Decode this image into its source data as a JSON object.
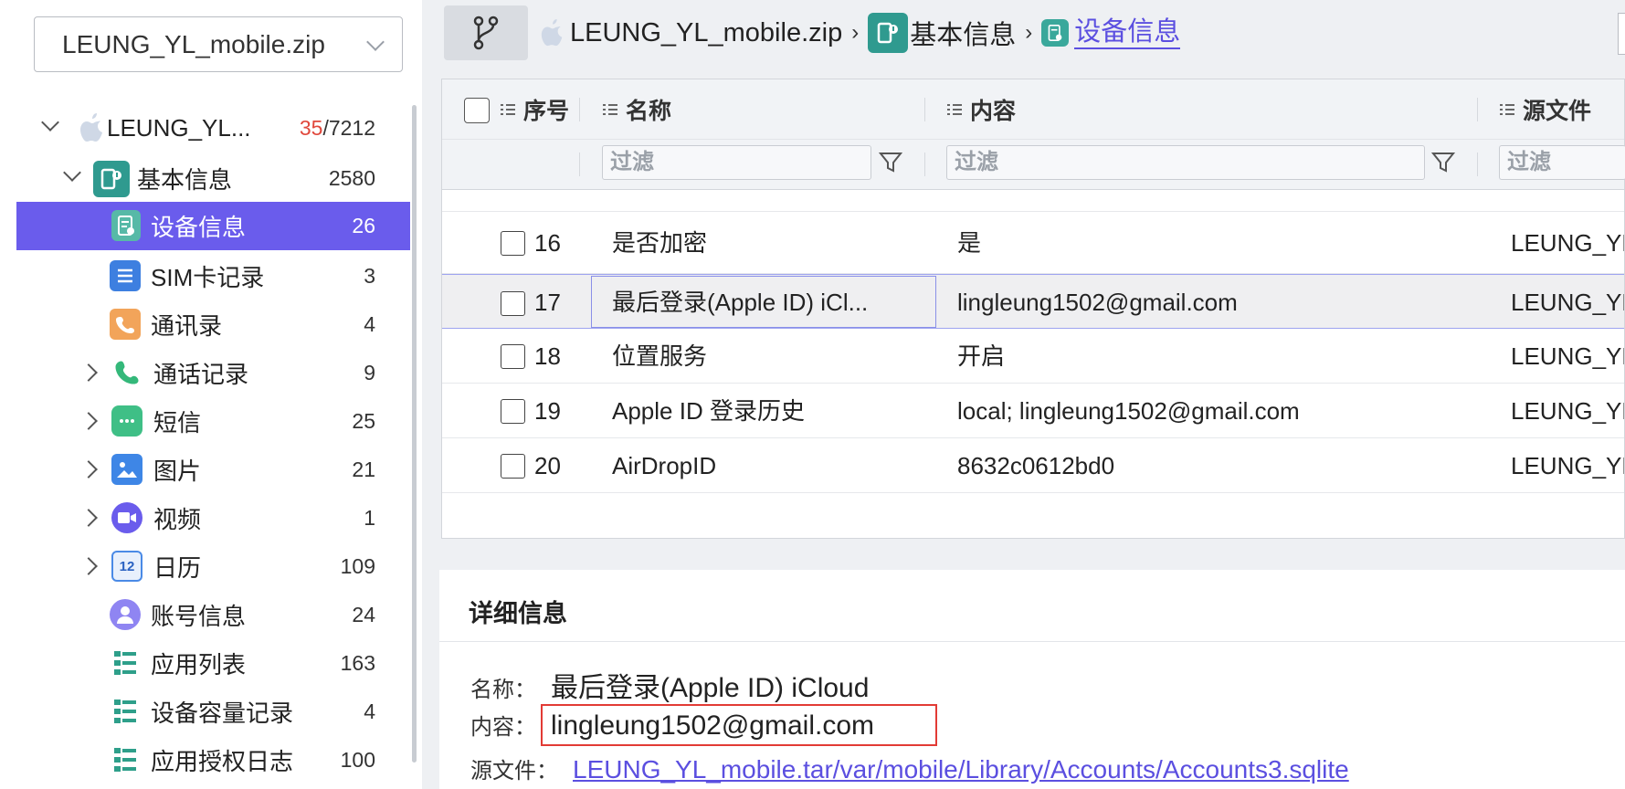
{
  "device_select": {
    "value": "LEUNG_YL_mobile.zip"
  },
  "tree": [
    {
      "label": "LEUNG_YL...",
      "count_highlight": "35",
      "count_total": "/7212",
      "expanded": true,
      "level": 0,
      "icon": "apple-icon"
    },
    {
      "label": "基本信息",
      "count": "2580",
      "expanded": true,
      "level": 1,
      "icon": "basic-info-icon"
    },
    {
      "label": "设备信息",
      "count": "26",
      "level": 2,
      "selected": true,
      "icon": "device-info-icon"
    },
    {
      "label": "SIM卡记录",
      "count": "3",
      "level": 2,
      "icon": "sim-card-icon"
    },
    {
      "label": "通讯录",
      "count": "4",
      "level": 2,
      "icon": "contacts-icon"
    },
    {
      "label": "通话记录",
      "count": "9",
      "level": 2,
      "collapsed": true,
      "icon": "phone-icon"
    },
    {
      "label": "短信",
      "count": "25",
      "level": 2,
      "collapsed": true,
      "icon": "sms-icon"
    },
    {
      "label": "图片",
      "count": "21",
      "level": 2,
      "collapsed": true,
      "icon": "image-icon"
    },
    {
      "label": "视频",
      "count": "1",
      "level": 2,
      "collapsed": true,
      "icon": "video-icon"
    },
    {
      "label": "日历",
      "count": "109",
      "level": 2,
      "collapsed": true,
      "icon": "calendar-icon"
    },
    {
      "label": "账号信息",
      "count": "24",
      "level": 2,
      "icon": "account-icon"
    },
    {
      "label": "应用列表",
      "count": "163",
      "level": 2,
      "icon": "app-list-icon"
    },
    {
      "label": "设备容量记录",
      "count": "4",
      "level": 2,
      "icon": "storage-record-icon"
    },
    {
      "label": "应用授权日志",
      "count": "100",
      "level": 2,
      "icon": "app-auth-log-icon"
    }
  ],
  "breadcrumb": {
    "root": "LEUNG_YL_mobile.zip",
    "sep": "›",
    "level1": "基本信息",
    "current": "设备信息"
  },
  "table": {
    "columns": [
      "序号",
      "名称",
      "内容",
      "源文件"
    ],
    "filter_placeholder": "过滤",
    "rows": [
      {
        "index": "16",
        "name": "是否加密",
        "content": "是",
        "source": "LEUNG_YL"
      },
      {
        "index": "17",
        "name": "最后登录(Apple ID) iCl...",
        "content": "lingleung1502@gmail.com",
        "source": "LEUNG_YL",
        "selected": true
      },
      {
        "index": "18",
        "name": "位置服务",
        "content": "开启",
        "source": "LEUNG_YL"
      },
      {
        "index": "19",
        "name": "Apple ID 登录历史",
        "content": "local; lingleung1502@gmail.com",
        "source": "LEUNG_YL"
      },
      {
        "index": "20",
        "name": "AirDropID",
        "content": "8632c0612bd0",
        "source": "LEUNG_YL"
      }
    ]
  },
  "detail": {
    "title": "详细信息",
    "name_label": "名称：",
    "name_value": "最后登录(Apple ID) iCloud",
    "content_label": "内容：",
    "content_value": "lingleung1502@gmail.com",
    "source_label": "源文件：",
    "source_value": "LEUNG_YL_mobile.tar/var/mobile/Library/Accounts/Accounts3.sqlite"
  },
  "colors": {
    "accent": "#6a5cec",
    "link": "#5b4fe0",
    "highlight_box": "#e23b35",
    "teal_icon": "#2f9a8f"
  }
}
